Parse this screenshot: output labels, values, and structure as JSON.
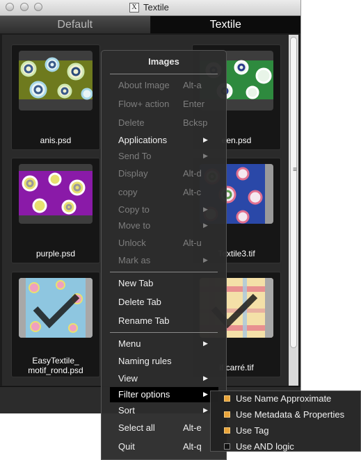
{
  "window": {
    "title": "Textile"
  },
  "tabs": [
    {
      "label": "Default",
      "active": false
    },
    {
      "label": "Textile",
      "active": true
    }
  ],
  "thumbnails": [
    {
      "name": "anis.psd"
    },
    {
      "name": "een.psd"
    },
    {
      "name": "purple.psd"
    },
    {
      "name": "Textile3.tif"
    },
    {
      "name": "EasyTextile_",
      "name2": "motif_rond.psd"
    },
    {
      "name": "if carré.tif"
    }
  ],
  "context_menu": {
    "header": "Images",
    "groups": [
      [
        {
          "label": "About Image",
          "shortcut": "Alt-a",
          "enabled": false
        },
        {
          "label": "Flow+ action",
          "shortcut": "Enter",
          "enabled": false
        },
        {
          "label": "Delete",
          "shortcut": "Bcksp",
          "enabled": false
        },
        {
          "label": "Applications",
          "submenu": true,
          "enabled": true
        },
        {
          "label": "Send To",
          "submenu": true,
          "enabled": false
        },
        {
          "label": "Display",
          "shortcut": "Alt-d",
          "enabled": false
        },
        {
          "label": "copy",
          "shortcut": "Alt-c",
          "enabled": false
        },
        {
          "label": "Copy to",
          "submenu": true,
          "enabled": false
        },
        {
          "label": "Move to",
          "submenu": true,
          "enabled": false
        },
        {
          "label": "Unlock",
          "shortcut": "Alt-u",
          "enabled": false
        },
        {
          "label": "Mark as",
          "submenu": true,
          "enabled": false
        }
      ],
      [
        {
          "label": "New Tab",
          "enabled": true
        },
        {
          "label": "Delete Tab",
          "enabled": true
        },
        {
          "label": "Rename Tab",
          "enabled": true
        }
      ],
      [
        {
          "label": "Menu",
          "submenu": true,
          "enabled": true
        },
        {
          "label": "Naming rules",
          "enabled": true
        },
        {
          "label": "View",
          "submenu": true,
          "enabled": true
        },
        {
          "label": "Filter options",
          "submenu": true,
          "enabled": true,
          "highlighted": true
        },
        {
          "label": "Sort",
          "submenu": true,
          "enabled": true
        },
        {
          "label": "Select all",
          "shortcut": "Alt-e",
          "enabled": true
        },
        {
          "label": "Quit",
          "shortcut": "Alt-q",
          "enabled": true
        }
      ]
    ]
  },
  "filter_submenu": [
    {
      "label": "Use Name Approximate",
      "checked": true
    },
    {
      "label": "Use Metadata & Properties",
      "checked": true
    },
    {
      "label": "Use Tag",
      "checked": true
    },
    {
      "label": "Use AND logic",
      "checked": false
    }
  ],
  "icons": {
    "submenu_arrow": "▶",
    "grip": "≡",
    "app_icon": "X"
  },
  "colors": {
    "checkbox_on": "#e9a43a",
    "menu_bg": "#2c2c2c",
    "highlight": "#000000"
  }
}
